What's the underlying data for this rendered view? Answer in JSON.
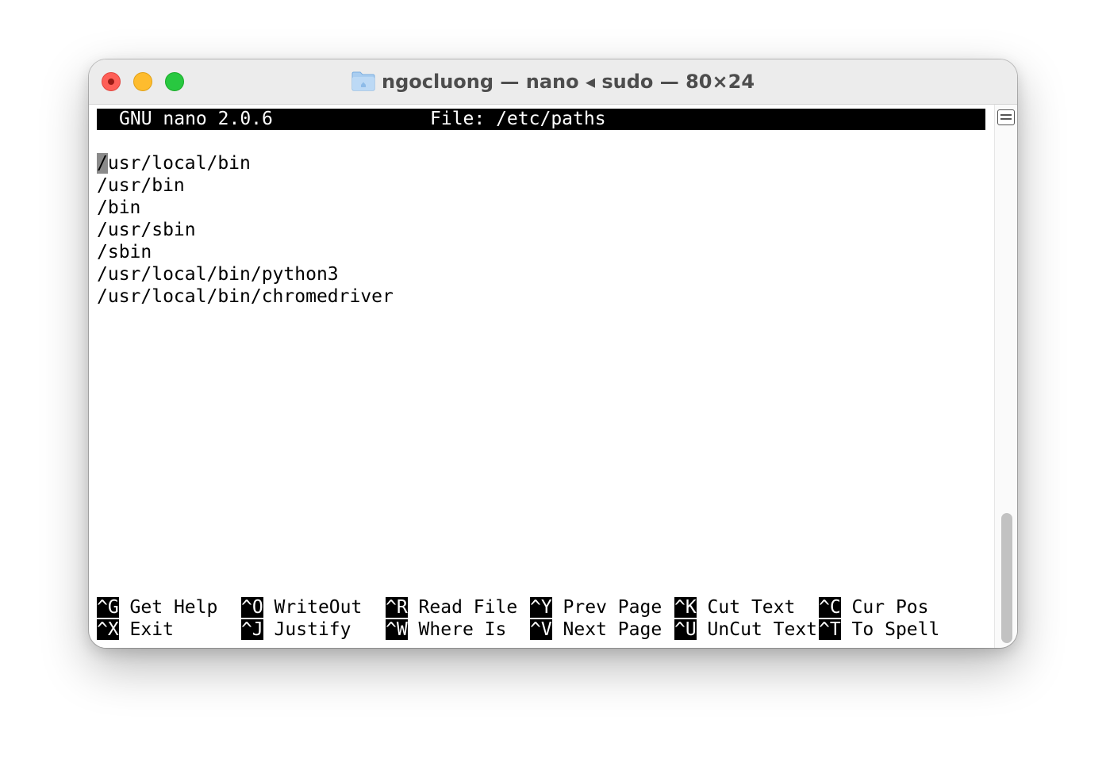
{
  "window": {
    "title": "ngocluong — nano ◂ sudo — 80×24"
  },
  "nano": {
    "version": "GNU nano 2.0.6",
    "file_label": "File: /etc/paths"
  },
  "buffer": {
    "cursor_char": "/",
    "first_line_rest": "usr/local/bin",
    "lines": [
      "/usr/bin",
      "/bin",
      "/usr/sbin",
      "/sbin",
      "/usr/local/bin/python3",
      "/usr/local/bin/chromedriver"
    ]
  },
  "shortcuts": {
    "row1": [
      {
        "key": "^G",
        "label": " Get Help"
      },
      {
        "key": "^O",
        "label": " WriteOut"
      },
      {
        "key": "^R",
        "label": " Read File"
      },
      {
        "key": "^Y",
        "label": " Prev Page"
      },
      {
        "key": "^K",
        "label": " Cut Text"
      },
      {
        "key": "^C",
        "label": " Cur Pos"
      }
    ],
    "row2": [
      {
        "key": "^X",
        "label": " Exit"
      },
      {
        "key": "^J",
        "label": " Justify"
      },
      {
        "key": "^W",
        "label": " Where Is"
      },
      {
        "key": "^V",
        "label": " Next Page"
      },
      {
        "key": "^U",
        "label": " UnCut Text"
      },
      {
        "key": "^T",
        "label": " To Spell"
      }
    ]
  },
  "icons": {
    "folder": "folder-icon",
    "scroll_toggle": "split-pane-icon"
  },
  "colors": {
    "close": "#fe5f57",
    "minimize": "#febc2e",
    "maximize": "#28c840"
  }
}
